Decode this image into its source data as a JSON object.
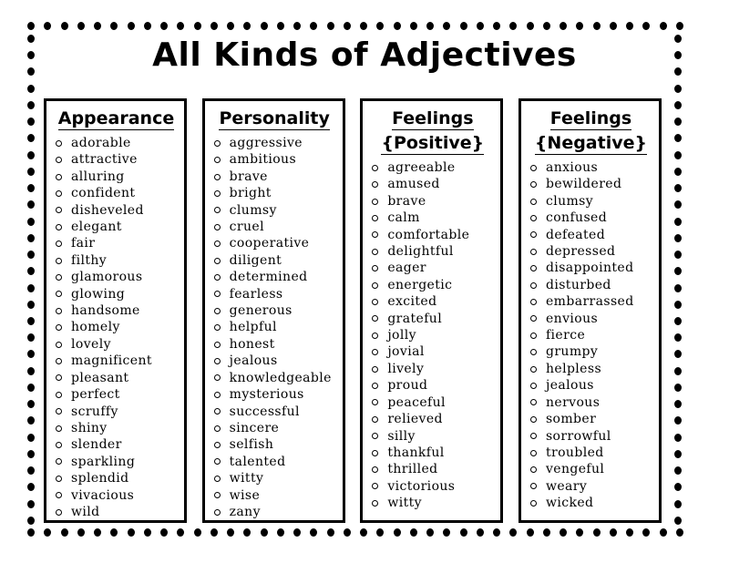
{
  "title": "All Kinds of Adjectives",
  "columns": [
    {
      "heading": [
        "Appearance"
      ],
      "words": [
        "adorable",
        "attractive",
        "alluring",
        "confident",
        "disheveled",
        "elegant",
        "fair",
        "filthy",
        "glamorous",
        "glowing",
        "handsome",
        "homely",
        "lovely",
        "magnificent",
        "pleasant",
        "perfect",
        "scruffy",
        "shiny",
        "slender",
        "sparkling",
        "splendid",
        "vivacious",
        "wild"
      ]
    },
    {
      "heading": [
        "Personality"
      ],
      "words": [
        "aggressive",
        "ambitious",
        "brave",
        "bright",
        "clumsy",
        "cruel",
        "cooperative",
        "diligent",
        "determined",
        "fearless",
        "generous",
        "helpful",
        "honest",
        "jealous",
        "knowledgeable",
        "mysterious",
        "successful",
        "sincere",
        "selfish",
        "talented",
        "witty",
        "wise",
        "zany"
      ]
    },
    {
      "heading": [
        "Feelings",
        "{Positive}"
      ],
      "words": [
        "agreeable",
        "amused",
        "brave",
        "calm",
        "comfortable",
        "delightful",
        "eager",
        "energetic",
        "excited",
        "grateful",
        "jolly",
        "jovial",
        "lively",
        "proud",
        "peaceful",
        "relieved",
        "silly",
        "thankful",
        "thrilled",
        "victorious",
        "witty"
      ]
    },
    {
      "heading": [
        "Feelings",
        "{Negative}"
      ],
      "words": [
        "anxious",
        "bewildered",
        "clumsy",
        "confused",
        "defeated",
        "depressed",
        "disappointed",
        "disturbed",
        "embarrassed",
        "envious",
        "fierce",
        "grumpy",
        "helpless",
        "jealous",
        "nervous",
        "somber",
        "sorrowful",
        "troubled",
        "vengeful",
        "weary",
        "wicked"
      ]
    }
  ]
}
